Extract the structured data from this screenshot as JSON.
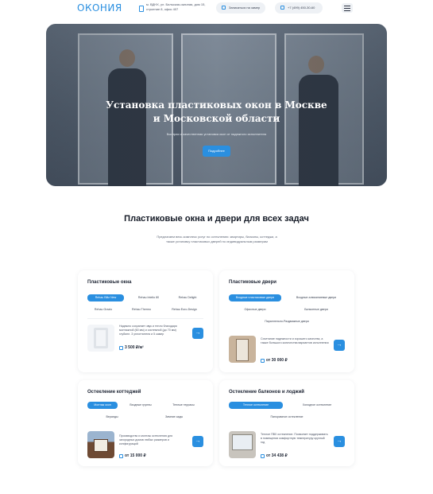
{
  "header": {
    "logo": "ОКОНИЯ",
    "address": "м. ВДНХ, ул. Бильская-окачная, дом 15, строение 8, офис 407",
    "callback_label": "Записаться на замер",
    "phone": "+7 (499) 450-30-60"
  },
  "hero": {
    "title_line1": "Установка пластиковых окон в Москве",
    "title_line2": "и Московской области",
    "subtitle": "Быстрая и качественная установка окон от надежного исполнителя",
    "button_label": "Подробнее"
  },
  "section": {
    "title": "Пластиковые окна и двери для всех задач",
    "description": "Предлагаем весь комплекс услуг по остеклению: квартиры, балконы, коттеджи, а также установку пластиковых дверей по индивидуальным размерам"
  },
  "cards": [
    {
      "title": "Пластиковые окна",
      "chips": [
        "Rehau Blitz New",
        "Rehau Intelio 80",
        "Rehau Delight",
        "Rehau Grazio",
        "Rehau Thermo",
        "Rehau Euro-Design"
      ],
      "active_chip": 0,
      "description": "Надежно сохраняет звук и тепло благодаря монтажной (60 мм) и системной (до 70 мм) глубине. 3 уплотнителя и 5 камер",
      "price": "3 500 ₽/м²"
    },
    {
      "title": "Пластиковые двери",
      "chips": [
        "Входные пластиковые двери",
        "Входные алюминиевые двери",
        "Офисные двери",
        "Балконные двери",
        "Параллельно-Раздвижные двери"
      ],
      "active_chip": 0,
      "description": "Сочетание надежности и хорошего качества, а также большого количества вариантов исполнения",
      "price": "от 30 000 ₽"
    },
    {
      "title": "Остекление коттеджей",
      "chips": [
        "Монтаж окон",
        "Входные группы",
        "Теплые террасы",
        "Веранды",
        "Зимние сады"
      ],
      "active_chip": 0,
      "description": "Производство и монтаж остекления для загородных домов любых размеров и конфигураций",
      "price": "от 15 000 ₽"
    },
    {
      "title": "Остекление балконов и лоджий",
      "chips": [
        "Теплое остекление",
        "Холодное остекление",
        "Панорамное остекление"
      ],
      "active_chip": 0,
      "description": "Теплое ПВХ остекление. Позволяет поддерживать в помещении комфортную температуру круглый год",
      "price": "от 34 438 ₽"
    }
  ],
  "colors": {
    "accent": "#2a8fe0",
    "text": "#1d2433"
  }
}
